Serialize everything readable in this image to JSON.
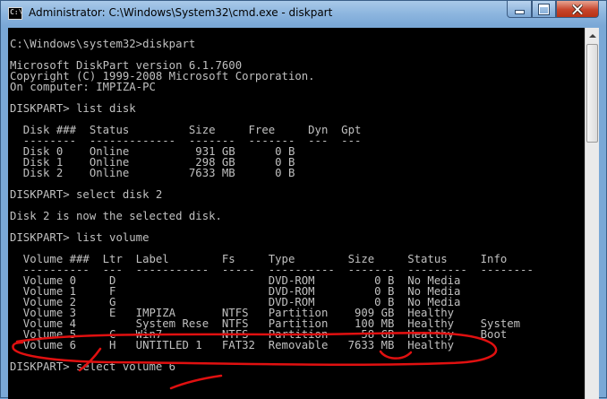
{
  "window": {
    "title": "Administrator: C:\\Windows\\System32\\cmd.exe - diskpart",
    "app_icon_text": "C:\\",
    "icons": [
      "cmd-icon",
      "minimize-icon",
      "maximize-icon",
      "close-icon"
    ],
    "colors": {
      "console_bg": "#000000",
      "console_fg": "#c0c0c0",
      "annotation": "#e01010"
    }
  },
  "console": {
    "lines": [
      "",
      "C:\\Windows\\system32>diskpart",
      "",
      "Microsoft DiskPart version 6.1.7600",
      "Copyright (C) 1999-2008 Microsoft Corporation.",
      "On computer: IMPIZA-PC",
      "",
      "DISKPART> list disk",
      "",
      "  Disk ###  Status         Size     Free     Dyn  Gpt",
      "  --------  -------------  -------  -------  ---  ---",
      "  Disk 0    Online          931 GB      0 B",
      "  Disk 1    Online          298 GB      0 B",
      "  Disk 2    Online         7633 MB      0 B",
      "",
      "DISKPART> select disk 2",
      "",
      "Disk 2 is now the selected disk.",
      "",
      "DISKPART> list volume",
      "",
      "  Volume ###  Ltr  Label        Fs     Type        Size     Status     Info",
      "  ----------  ---  -----------  -----  ----------  -------  ---------  --------",
      "  Volume 0     D                       DVD-ROM         0 B  No Media",
      "  Volume 1     F                       DVD-ROM         0 B  No Media",
      "  Volume 2     G                       DVD-ROM         0 B  No Media",
      "  Volume 3     E   IMPIZA       NTFS   Partition    909 GB  Healthy",
      "  Volume 4         System Rese  NTFS   Partition    100 MB  Healthy    System",
      "  Volume 5     C   Win7         NTFS   Partition     58 GB  Healthy    Boot",
      "  Volume 6     H   UNTITLED 1   FAT32  Removable   7633 MB  Healthy",
      "",
      "DISKPART> select volume 6",
      "",
      ""
    ]
  }
}
